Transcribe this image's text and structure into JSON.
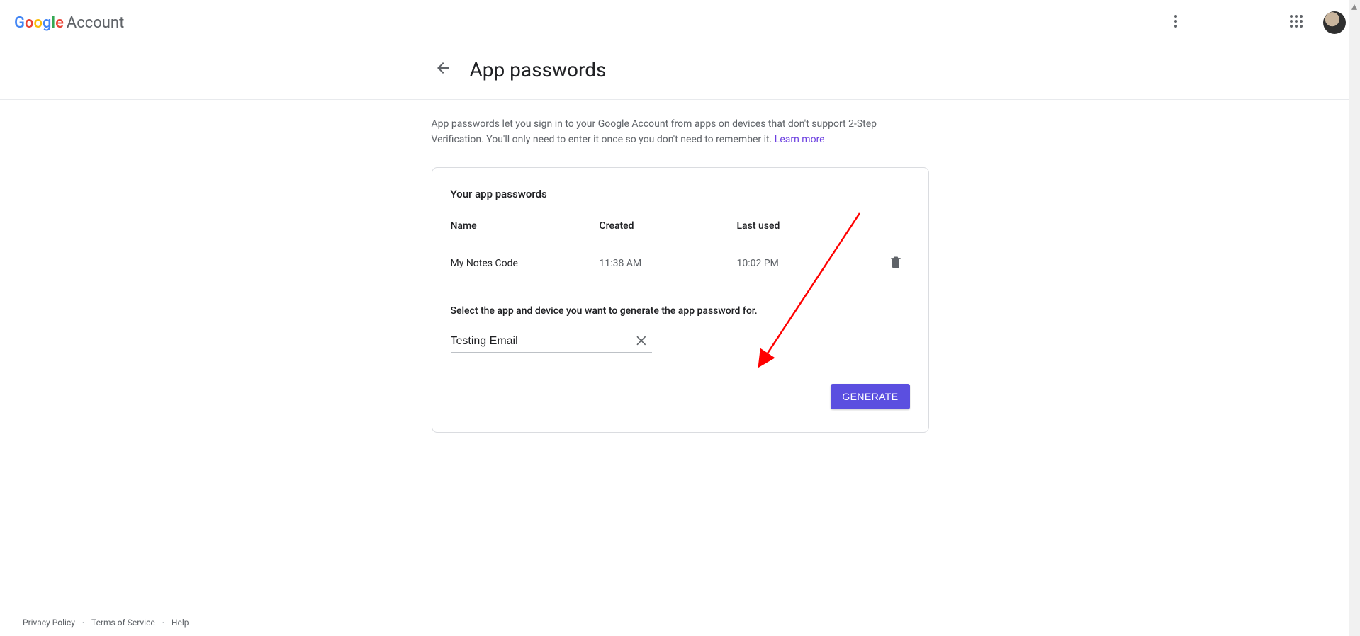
{
  "header": {
    "logo_account": "Account"
  },
  "page": {
    "title": "App passwords",
    "intro_text": "App passwords let you sign in to your Google Account from apps on devices that don't support 2-Step Verification. You'll only need to enter it once so you don't need to remember it. ",
    "learn_more": "Learn more"
  },
  "card": {
    "section_title": "Your app passwords",
    "cols": {
      "name": "Name",
      "created": "Created",
      "last_used": "Last used"
    },
    "rows": [
      {
        "name": "My Notes Code",
        "created": "11:38 AM",
        "last_used": "10:02 PM"
      }
    ],
    "select_label": "Select the app and device you want to generate the app password for.",
    "input_value": "Testing Email",
    "generate_label": "GENERATE"
  },
  "footer": {
    "privacy": "Privacy Policy",
    "terms": "Terms of Service",
    "help": "Help"
  }
}
